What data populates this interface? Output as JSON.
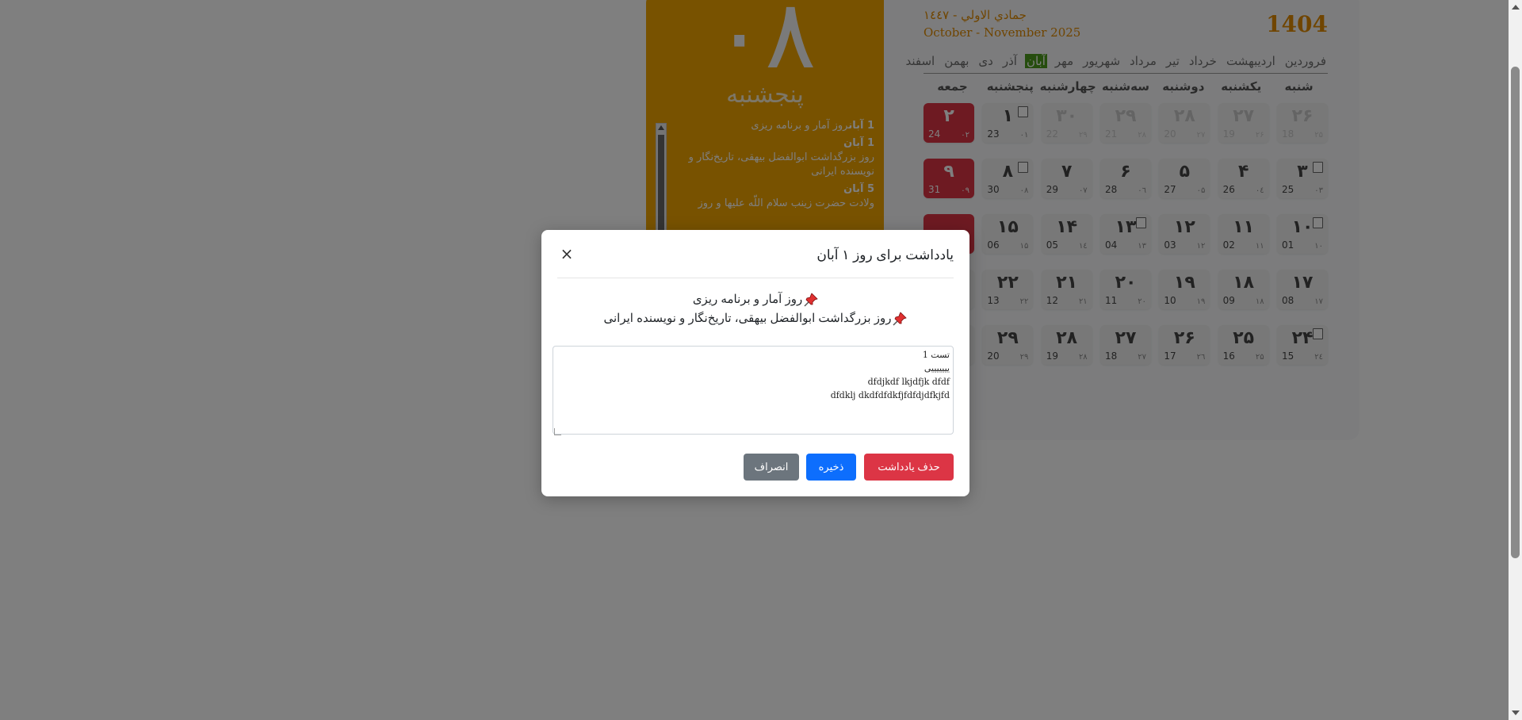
{
  "today": {
    "number": "۰۸",
    "weekday": "پنجشنبه",
    "events": [
      {
        "date": "1 آبان",
        "text": "روز آمار و برنامه ریزی"
      },
      {
        "date": "1 آبان",
        "text": "روز بزرگداشت ابوالفضل بیهقی، تاریخ‌نگار و نویسنده ایرانی"
      },
      {
        "date": "5 آبان",
        "text": "ولادت حضرت زینب سلام اللّه علیها و روز"
      }
    ]
  },
  "header": {
    "year": "1404",
    "hijri": "جمادي الاولي - ١٤٤٧",
    "gregorian": "October - November 2025"
  },
  "months": [
    "فروردین",
    "اردیبهشت",
    "خرداد",
    "تیر",
    "مرداد",
    "شهریور",
    "مهر",
    "آبان",
    "آذر",
    "دی",
    "بهمن",
    "اسفند"
  ],
  "active_month": "آبان",
  "weekdays": [
    "شنبه",
    "یکشنبه",
    "دوشنبه",
    "سه‌شنبه",
    "چهارشنبه",
    "پنجشنبه",
    "جمعه"
  ],
  "weeks": [
    [
      {
        "pn": "۲۶",
        "gn": "18",
        "hn": "۲۵",
        "faded": true
      },
      {
        "pn": "۲۷",
        "gn": "19",
        "hn": "۲۶",
        "faded": true
      },
      {
        "pn": "۲۸",
        "gn": "20",
        "hn": "۲۷",
        "faded": true
      },
      {
        "pn": "۲۹",
        "gn": "21",
        "hn": "۲۸",
        "faded": true
      },
      {
        "pn": "۳۰",
        "gn": "22",
        "hn": "۲۹",
        "faded": true
      },
      {
        "pn": "۱",
        "gn": "23",
        "hn": "۰۱",
        "note": true
      },
      {
        "pn": "۲",
        "gn": "24",
        "hn": "۰۲",
        "holiday": true
      }
    ],
    [
      {
        "pn": "۳",
        "gn": "25",
        "hn": "۰۳",
        "note": true
      },
      {
        "pn": "۴",
        "gn": "26",
        "hn": "۰٤"
      },
      {
        "pn": "۵",
        "gn": "27",
        "hn": "۰۵"
      },
      {
        "pn": "۶",
        "gn": "28",
        "hn": "۰٦"
      },
      {
        "pn": "۷",
        "gn": "29",
        "hn": "۰۷"
      },
      {
        "pn": "۸",
        "gn": "30",
        "hn": "۰۸",
        "note": true
      },
      {
        "pn": "۹",
        "gn": "31",
        "hn": "۰۹",
        "holiday": true
      }
    ],
    [
      {
        "pn": "۱۰",
        "gn": "01",
        "hn": "۱۰",
        "note": true
      },
      {
        "pn": "۱۱",
        "gn": "02",
        "hn": "۱۱"
      },
      {
        "pn": "۱۲",
        "gn": "03",
        "hn": "۱۲"
      },
      {
        "pn": "۱۳",
        "gn": "04",
        "hn": "۱۳",
        "note": true
      },
      {
        "pn": "۱۴",
        "gn": "05",
        "hn": "۱٤"
      },
      {
        "pn": "۱۵",
        "gn": "06",
        "hn": "۱۵"
      },
      {
        "pn": "",
        "gn": "",
        "hn": "",
        "holiday": true
      }
    ],
    [
      {
        "pn": "۱۷",
        "gn": "08",
        "hn": "۱۷"
      },
      {
        "pn": "۱۸",
        "gn": "09",
        "hn": "۱۸"
      },
      {
        "pn": "۱۹",
        "gn": "10",
        "hn": "۱۹"
      },
      {
        "pn": "۲۰",
        "gn": "11",
        "hn": "۲۰"
      },
      {
        "pn": "۲۱",
        "gn": "12",
        "hn": "۲۱"
      },
      {
        "pn": "۲۲",
        "gn": "13",
        "hn": "۲۲"
      },
      {
        "pn": "",
        "gn": "",
        "hn": ""
      }
    ],
    [
      {
        "pn": "۲۴",
        "gn": "15",
        "hn": "۲٤",
        "note": true
      },
      {
        "pn": "۲۵",
        "gn": "16",
        "hn": "۲۵"
      },
      {
        "pn": "۲۶",
        "gn": "17",
        "hn": "۲٦"
      },
      {
        "pn": "۲۷",
        "gn": "18",
        "hn": "۲۷"
      },
      {
        "pn": "۲۸",
        "gn": "19",
        "hn": "۲۸"
      },
      {
        "pn": "۲۹",
        "gn": "20",
        "hn": "۲۹"
      },
      {
        "pn": "",
        "gn": "",
        "hn": ""
      }
    ]
  ],
  "modal": {
    "title": "یادداشت برای روز ۱ آبان",
    "close": "×",
    "events": [
      "روز آمار و برنامه ریزی",
      "روز بزرگداشت ابوالفضل بیهقی، تاریخ‌نگار و نویسنده ایرانی"
    ],
    "note_text": "تست 1\nیییییییی\ndfdjkdf lkjdfjk dfdf\ndfdklj dkdfdfdkfjfdfdjdfkjfd",
    "delete_label": "حذف یادداشت",
    "save_label": "ذخیره",
    "cancel_label": "انصراف"
  },
  "colors": {
    "today_panel": "#f0a400",
    "accent": "#e08a00",
    "active_month": "#4d9a1c",
    "holiday": "#dc3545",
    "save": "#0d6efd",
    "cancel": "#6c757d",
    "overlay": "rgba(0,0,0,0.5)"
  },
  "icons": {
    "pin": "pushpin-icon",
    "note": "note-icon",
    "close": "close-icon"
  }
}
